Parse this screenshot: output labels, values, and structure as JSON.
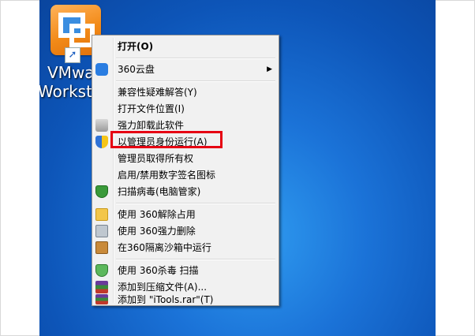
{
  "desktop": {
    "icon_label_line1": "VMwa",
    "icon_label_line2": "Worksta"
  },
  "menu": {
    "items": [
      {
        "label": "打开(O)",
        "icon": "none",
        "bold": true
      },
      {
        "label": "360云盘",
        "icon": "cloud-icon",
        "submenu": true
      },
      {
        "label": "兼容性疑难解答(Y)",
        "icon": "none"
      },
      {
        "label": "打开文件位置(I)",
        "icon": "none"
      },
      {
        "label": "强力卸载此软件",
        "icon": "trash-icon"
      },
      {
        "label": "以管理员身份运行(A)",
        "icon": "uac-shield-icon"
      },
      {
        "label": "管理员取得所有权",
        "icon": "none"
      },
      {
        "label": "启用/禁用数字签名图标",
        "icon": "none"
      },
      {
        "label": "扫描病毒(电脑管家)",
        "icon": "guard-shield-icon"
      },
      {
        "label": "使用 360解除占用",
        "icon": "folder-unlock-icon"
      },
      {
        "label": "使用 360强力删除",
        "icon": "shredder-icon"
      },
      {
        "label": "在360隔离沙箱中运行",
        "icon": "sandbox-icon"
      },
      {
        "label": "使用 360杀毒 扫描",
        "icon": "antivirus-icon"
      },
      {
        "label": "添加到压缩文件(A)...",
        "icon": "rar-icon"
      },
      {
        "label": "添加到 \"iTools.rar\"(T)",
        "icon": "rar-icon"
      }
    ],
    "submenu_arrow": "▶",
    "highlight_color": "#e60012"
  }
}
